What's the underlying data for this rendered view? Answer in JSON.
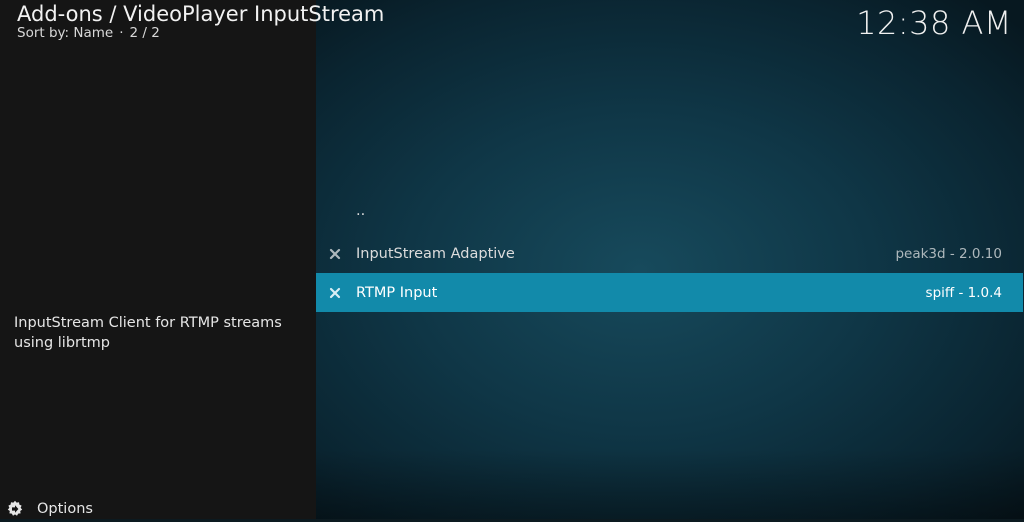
{
  "header": {
    "title": "Add-ons / VideoPlayer InputStream",
    "sort_label": "Sort by: Name",
    "separator": "·",
    "page": "2 / 2"
  },
  "clock": "12:38 AM",
  "description": "InputStream Client for RTMP streams using librtmp",
  "footer": {
    "options_label": "Options",
    "options_icon": "gear-icon"
  },
  "list": {
    "parent_label": "..",
    "items": [
      {
        "name": "InputStream Adaptive",
        "meta": "peak3d - 2.0.10",
        "status_icon": "disabled-x-icon",
        "selected": false
      },
      {
        "name": "RTMP Input",
        "meta": "spiff - 1.0.4",
        "status_icon": "disabled-x-icon",
        "selected": true
      }
    ]
  },
  "colors": {
    "highlight": "#128aaa",
    "left_panel": "#151515",
    "background": "#0f3646"
  }
}
